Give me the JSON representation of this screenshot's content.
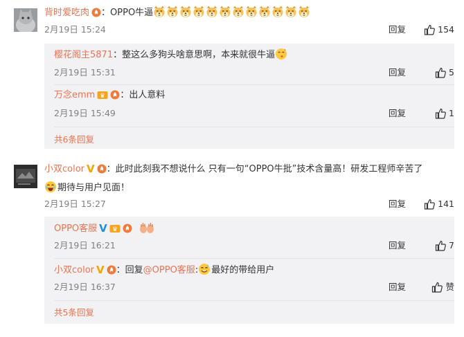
{
  "comments": [
    {
      "user": "背时爱吃肉",
      "sep": "：",
      "text": "OPPO牛逼",
      "emoji_count": 12,
      "time": "2月19日 15:24",
      "reply_label": "回复",
      "likes": "154",
      "replies": [
        {
          "user": "樱花阁主5871",
          "sep": "：",
          "text": "整这么多狗头啥意思啊，本来就很牛逼",
          "time": "2月19日 15:31",
          "reply_label": "回复",
          "likes": "5"
        },
        {
          "user": "万念emm",
          "sep": "：",
          "text": "出人意料",
          "time": "2月19日 15:49",
          "reply_label": "回复",
          "likes": "1"
        }
      ],
      "more_label": "共6条回复"
    },
    {
      "user": "小双color",
      "sep": "：",
      "text_line1": "此时此刻我不想说什么 只有一句“OPPO牛批”技术含量高！研发工程师辛苦了",
      "text_line2": "期待与用户见面！",
      "time": "2月19日 15:27",
      "reply_label": "回复",
      "likes": "141",
      "replies": [
        {
          "user": "OPPO客服",
          "time": "2月19日 16:21",
          "reply_label": "回复",
          "likes": "7"
        },
        {
          "user": "小双color",
          "sep": "：",
          "reply_prefix": "回复",
          "mention": "@OPPO客服",
          "sep2": ":",
          "text": "最好的带给用户",
          "time": "2月19日 16:37",
          "reply_label": "回复",
          "likes": "赞"
        }
      ],
      "more_label": "共5条回复"
    }
  ],
  "colors": {
    "accent": "#eb7350",
    "sub_bg": "#f2f2f5",
    "meta": "#808080"
  },
  "icons": [
    "dog-emoji-icon",
    "sweat-smile-emoji-icon",
    "laugh-emoji-icon",
    "hands-emoji-icon",
    "thumbs-up-icon",
    "orange-v-badge",
    "blue-v-badge",
    "member-badge-icon",
    "fire-badge-icon"
  ]
}
